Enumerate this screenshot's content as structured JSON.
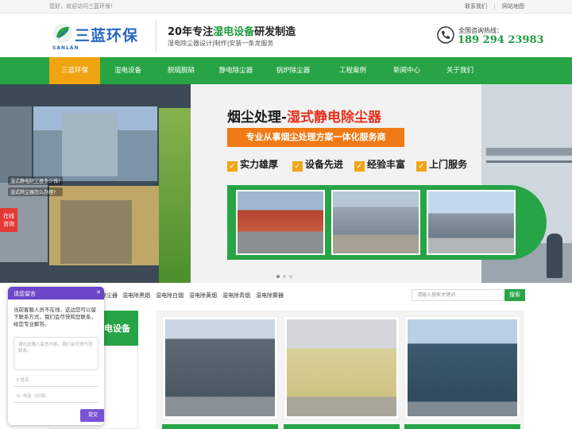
{
  "topbar": {
    "welcome": "您好，欢迎访问三蓝环保！",
    "links": [
      "联系我们",
      "网站地图"
    ],
    "separator": "|"
  },
  "header": {
    "logo_text": "三蓝环保",
    "logo_sub": "SANLAN",
    "slogan_pre": "20年专注",
    "slogan_hl": "湿电设备",
    "slogan_post": "研发制造",
    "slogan_sub": "湿电除尘器设计|制作|安装一条龙服务",
    "phone_label": "全国咨询热线：",
    "phone_number": "189 294 23983"
  },
  "nav": {
    "items": [
      "三蓝环保",
      "湿电设备",
      "脱硫脱硝",
      "静电除尘器",
      "锅炉除尘器",
      "工程案例",
      "新闻中心",
      "关于我们"
    ],
    "active_index": 0
  },
  "banner": {
    "title_pre": "烟尘处理-",
    "title_hl": "湿式静电除尘器",
    "bar_text": "专业从事烟尘处理方案一体化服务商",
    "features": [
      "实力雄厚",
      "设备先进",
      "经验丰富",
      "上门服务"
    ],
    "check_glyph": "✓",
    "chat_lines": [
      "湿式静电除尘器多少钱?",
      "湿式除尘器怎么办理?"
    ],
    "online_text": [
      "在线",
      "咨询"
    ],
    "active_slide": 0
  },
  "keywords": {
    "items": [
      "湿电除尘器",
      "湿电除黑烟",
      "湿电除白烟",
      "湿电除黄烟",
      "湿电除青烟",
      "湿电除雾器"
    ]
  },
  "search": {
    "placeholder": "请输入搜索关键词",
    "button": "搜索"
  },
  "products": {
    "sidebar_title": "湿电设备"
  },
  "message": {
    "title": "请您留言",
    "close_glyph": "✕",
    "intro": "当前客服人员不在线，这边您可以留下联系方式，我们会尽快和您联系，给您专业解答。",
    "textarea_placeholder": "请在此输入留言内容，我们会尽快与您联系。",
    "name_placeholder": "姓名",
    "phone_placeholder": "电话（必填）",
    "submit": "提交"
  },
  "colors": {
    "brand_green": "#27a445",
    "nav_active": "#f0a412",
    "logo_blue": "#2a67c4",
    "accent_orange": "#f07a16",
    "accent_red": "#e5301c",
    "widget_purple": "#6d46c8"
  }
}
